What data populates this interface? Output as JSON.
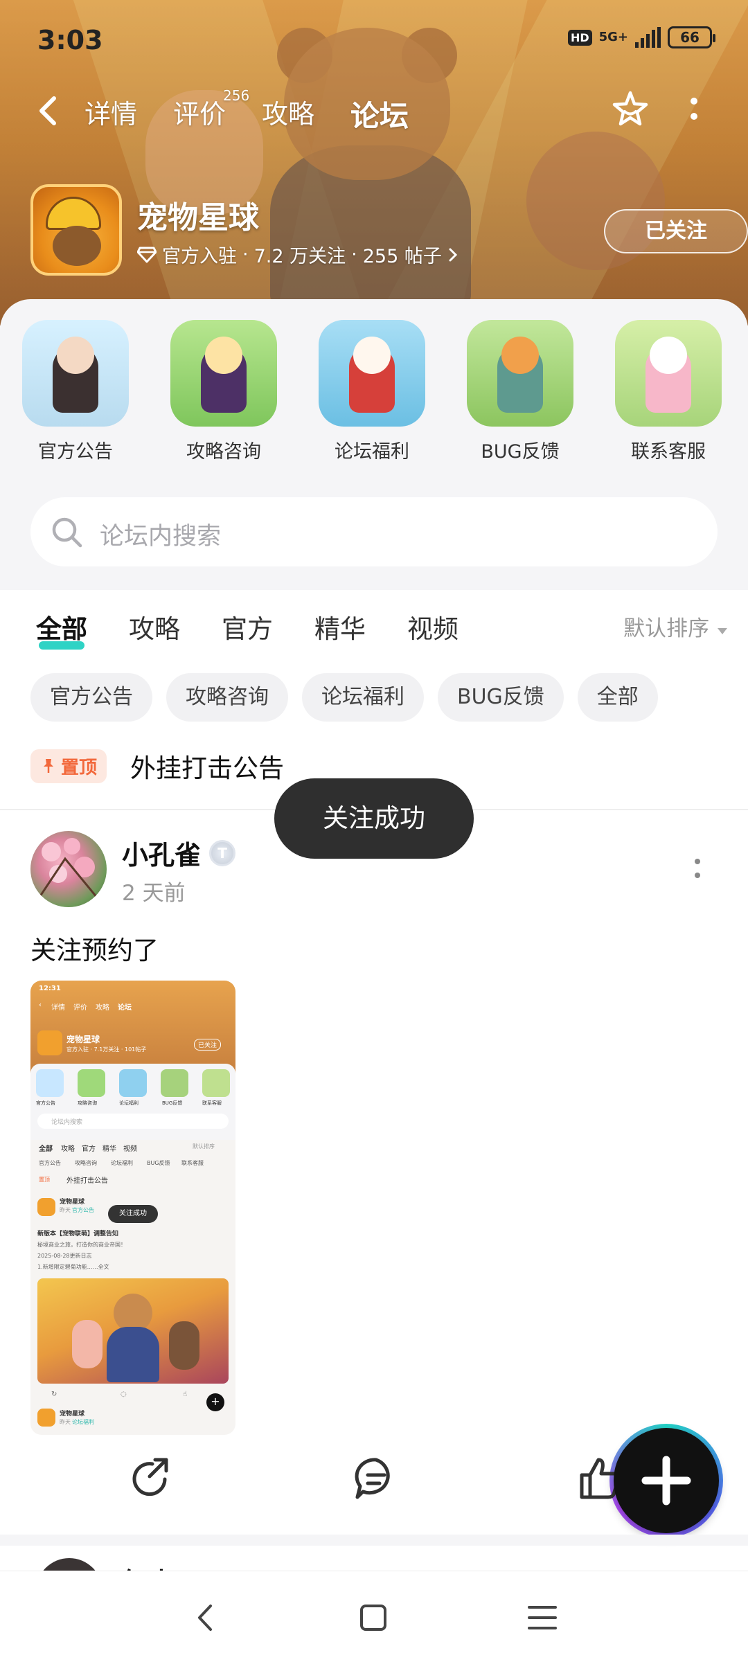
{
  "status_bar": {
    "time": "3:03",
    "hd": "HD",
    "network": "5G+",
    "battery": "66"
  },
  "nav": {
    "tabs": [
      {
        "label": "详情"
      },
      {
        "label": "评价",
        "badge": "256"
      },
      {
        "label": "攻略"
      },
      {
        "label": "论坛",
        "active": true
      }
    ]
  },
  "game": {
    "title": "宠物星球",
    "verified": "官方入驻",
    "followers": "7.2 万关注",
    "posts": "255 帖子",
    "sep": "·",
    "follow_button": "已关注"
  },
  "categories": [
    {
      "label": "官方公告",
      "color": "#c8e7ff"
    },
    {
      "label": "攻略咨询",
      "color": "#9fd97a"
    },
    {
      "label": "论坛福利",
      "color": "#8fd0ef"
    },
    {
      "label": "BUG反馈",
      "color": "#a6d27c"
    },
    {
      "label": "联系客服",
      "color": "#bfe08f"
    }
  ],
  "search": {
    "placeholder": "论坛内搜索"
  },
  "filter_tabs": [
    {
      "label": "全部",
      "active": true
    },
    {
      "label": "攻略"
    },
    {
      "label": "官方"
    },
    {
      "label": "精华"
    },
    {
      "label": "视频"
    }
  ],
  "sort_label": "默认排序",
  "chips": [
    "官方公告",
    "攻略咨询",
    "论坛福利",
    "BUG反馈",
    "全部"
  ],
  "pinned": {
    "badge": "置顶",
    "title": "外挂打击公告"
  },
  "post": {
    "user": "小孔雀",
    "level": "T",
    "time": "2 天前",
    "text": "关注预约了"
  },
  "mini_screenshot": {
    "time": "12:31",
    "tabs": [
      "详情",
      "评价",
      "攻略",
      "论坛"
    ],
    "title": "宠物星球",
    "sub": "官方入驻 · 7.1万关注 · 101帖子",
    "follow": "已关注",
    "cats": [
      "官方公告",
      "攻略咨询",
      "论坛福利",
      "BUG反馈",
      "联系客服"
    ],
    "search": "论坛内搜索",
    "ftabs": [
      "全部",
      "攻略",
      "官方",
      "精华",
      "视频"
    ],
    "sort": "默认排序",
    "chips": [
      "官方公告",
      "攻略咨询",
      "论坛福利",
      "BUG反馈",
      "联系客服"
    ],
    "pin_badge": "置顶",
    "pin_title": "外挂打击公告",
    "post_user": "宠物星球",
    "post_meta": "昨天",
    "post_tag": "官方公告",
    "toast": "关注成功",
    "post_title": "新版本【宠物联萌】调整告知",
    "post_line1": "秘境商业之旅，打造你的商业帝国！",
    "post_line2": "2025-08-28更新日志",
    "post_line3": "1.新增限定碧菊功能……全文",
    "post2_user": "宠物星球",
    "post2_meta": "昨天",
    "post2_tag": "论坛福利"
  },
  "next_post": {
    "user": "红山三"
  },
  "toast": "关注成功",
  "colors": {
    "accent": "#2fd3c5",
    "pin": "#f2683b",
    "banner": "#e7a34e"
  }
}
